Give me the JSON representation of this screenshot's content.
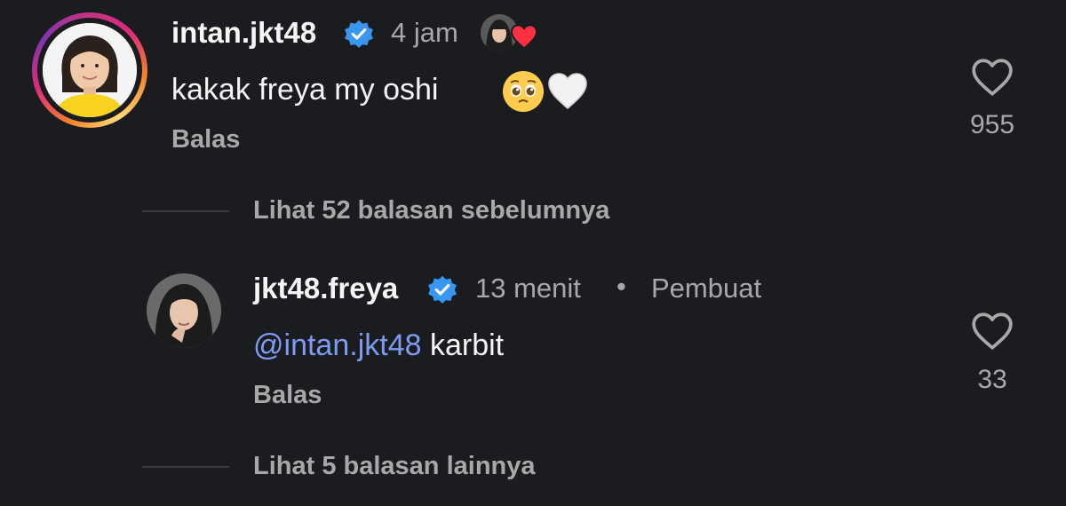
{
  "top_comment": {
    "username": "intan.jkt48",
    "time": "4 jam",
    "text": "kakak freya my oshi",
    "reply_label": "Balas",
    "likes": "955",
    "icons": {
      "verified": "verified-badge-icon",
      "like": "heart-outline-icon",
      "creator_like": "creator-liked-heart-icon"
    }
  },
  "view_previous": "Lihat 52 balasan sebelumnya",
  "reply_comment": {
    "username": "jkt48.freya",
    "time": "13 menit",
    "separator": "•",
    "tag": "Pembuat",
    "mention": "@intan.jkt48",
    "text": " karbit",
    "reply_label": "Balas",
    "likes": "33"
  },
  "view_more": "Lihat 5 balasan lainnya",
  "colors": {
    "background": "#1b1c20",
    "text_primary": "#f5f5f5",
    "text_secondary": "#a8a8a8",
    "mention": "#7d9bf2",
    "verified": "#3897f0",
    "heart_red": "#ff3040"
  }
}
